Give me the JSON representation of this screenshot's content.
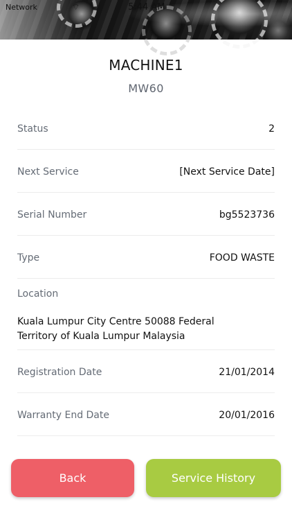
{
  "status_bar": {
    "carrier": "Network",
    "time": "5:44 AM"
  },
  "header": {
    "title": "MACHINE1",
    "subtitle": "MW60"
  },
  "details": {
    "status_label": "Status",
    "status_value": "2",
    "next_service_label": "Next Service",
    "next_service_value": "[Next Service Date]",
    "serial_number_label": "Serial Number",
    "serial_number_value": "bg5523736",
    "type_label": "Type",
    "type_value": "FOOD WASTE",
    "location_label": "Location",
    "location_value": "Kuala Lumpur City Centre 50088 Federal Territory of Kuala Lumpur Malaysia",
    "registration_date_label": "Registration Date",
    "registration_date_value": "21/01/2014",
    "warranty_end_date_label": "Warranty End Date",
    "warranty_end_date_value": "20/01/2016"
  },
  "actions": {
    "back_label": "Back",
    "service_history_label": "Service History"
  },
  "colors": {
    "back_button": "#ee5f67",
    "service_history_button": "#a8cb42",
    "label_text": "#646b75",
    "value_text": "#111111"
  },
  "icons": {
    "status_bar_wifi": "wifi-icon"
  }
}
